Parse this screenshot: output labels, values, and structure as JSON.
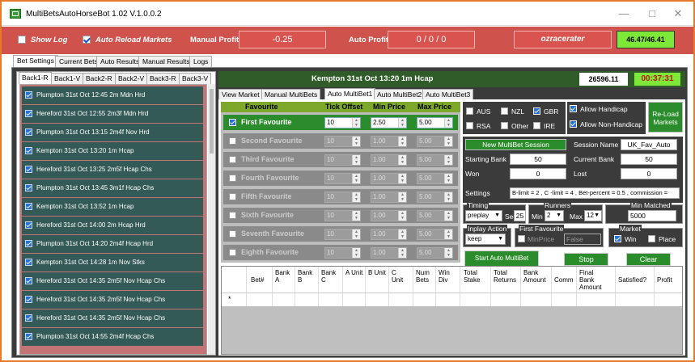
{
  "window": {
    "title": "MultiBetsAutoHorseBot 1.02 V.1.0.0.2",
    "minimize": "—",
    "maximize": "□",
    "close": "✕"
  },
  "toolbar": {
    "show_log": "Show Log",
    "auto_reload": "Auto Reload Markets",
    "manual_profit_label": "Manual Profit",
    "manual_profit_value": "-0.25",
    "auto_profit_label": "Auto Profit",
    "auto_profit_value": "0 / 0 / 0",
    "username": "ozracerater",
    "balance": "46.47/46.41"
  },
  "main_tabs": [
    "Bet Settings",
    "Current Bets",
    "Auto Results",
    "Manual Results",
    "Logs"
  ],
  "left_tabs": [
    "Back1-R",
    "Back1-V",
    "Back2-R",
    "Back2-V",
    "Back3-R",
    "Back3-V"
  ],
  "races": [
    "Plumpton 31st Oct 12:45 2m Mdn Hrd",
    "Hereford 31st Oct 12:55 2m3f Mdn Hrd",
    "Plumpton 31st Oct 13:15 2m4f Nov Hrd",
    "Kempton 31st Oct 13:20 1m Hcap",
    "Hereford 31st Oct 13:25 2m5f Hcap Chs",
    "Plumpton 31st Oct 13:45 3m1f Hcap Chs",
    "Kempton 31st Oct 13:52 1m Hcap",
    "Hereford 31st Oct 14:00 2m Hcap Hrd",
    "Plumpton 31st Oct 14:20 2m4f Hcap Hrd",
    "Kempton 31st Oct 14:28 1m Nov Stks",
    "Hereford 31st Oct 14:35 2m5f Nov Hcap Chs",
    "Hereford 31st Oct 14:35 2m5f Nov Hcap Chs",
    "Hereford 31st Oct 14:35 2m5f Nov Hcap Chs",
    "Plumpton 31st Oct 14:55 2m4f Hcap Chs"
  ],
  "race_header": {
    "title": "Kempton 31st Oct 13:20 1m Hcap",
    "figure": "26596.11",
    "clock": "00:37:31"
  },
  "sub_tabs": [
    "View Market",
    "Manual MultiBets",
    "Auto MultiBet1",
    "Auto MultiBet2",
    "Auto MultiBet3"
  ],
  "fav_headers": {
    "favourite": "Favourite",
    "tick": "Tick Offset",
    "min": "Min Price",
    "max": "Max Price"
  },
  "favourites": [
    {
      "name": "First Favourite",
      "tick": "10",
      "min": "2.50",
      "max": "5.00",
      "checked": true
    },
    {
      "name": "Second Favourite",
      "tick": "10",
      "min": "1.00",
      "max": "5.00",
      "checked": false
    },
    {
      "name": "Third Favourite",
      "tick": "10",
      "min": "1.00",
      "max": "5.00",
      "checked": false
    },
    {
      "name": "Fourth Favourite",
      "tick": "10",
      "min": "1.00",
      "max": "5.00",
      "checked": false
    },
    {
      "name": "Fifth Favourite",
      "tick": "10",
      "min": "1.00",
      "max": "5.00",
      "checked": false
    },
    {
      "name": "Sixth Favourite",
      "tick": "10",
      "min": "1.00",
      "max": "5.00",
      "checked": false
    },
    {
      "name": "Seventh Favourite",
      "tick": "10",
      "min": "1.00",
      "max": "5.00",
      "checked": false
    },
    {
      "name": "Eighth Favourite",
      "tick": "10",
      "min": "1.00",
      "max": "5.00",
      "checked": false
    }
  ],
  "countries": {
    "aus": "AUS",
    "nzl": "NZL",
    "gbr": "GBR",
    "rsa": "RSA",
    "other": "Other",
    "ire": "IRE"
  },
  "handicap": {
    "allow": "Allow Handicap",
    "allow_non": "Allow Non-Handicap"
  },
  "reload_label": "Re-Load Markets",
  "session": {
    "new_btn": "New MultiBet Session",
    "session_name_label": "Session Name",
    "session_name": "UK_Fav_Auto",
    "starting_bank_label": "Starting Bank",
    "starting_bank": "50",
    "current_bank_label": "Current Bank",
    "current_bank": "50",
    "won_label": "Won",
    "won": "0",
    "lost_label": "Lost",
    "lost": "0",
    "settings_label": "Settings",
    "settings": "B-limit = 2 , C -limit = 4 , Bet-percent = 0.5 , commission ="
  },
  "timing": {
    "label": "Timing",
    "mode": "preplay",
    "sec_label": "Sec",
    "sec": "25"
  },
  "runners": {
    "label": "Runners",
    "min_label": "Min",
    "min": "2",
    "max_label": "Max",
    "max": "12"
  },
  "min_matched": {
    "label": "Min Matched",
    "value": "5000"
  },
  "inplay": {
    "label": "Inplay Action",
    "value": "keep"
  },
  "first_fav": {
    "label": "First Favourite",
    "minprice_label": "MinPrice",
    "value": "False"
  },
  "market": {
    "label": "Market",
    "win": "Win",
    "place": "Place"
  },
  "buttons": {
    "start": "Start Auto MultiBet",
    "stop": "Stop",
    "clear": "Clear"
  },
  "grid": {
    "columns": [
      "Bet#",
      "Bank A",
      "Bank B",
      "Bank C",
      "A Unit",
      "B Unit",
      "C Unit",
      "Num Bets",
      "Win Div",
      "Total Stake",
      "Total Returns",
      "Bank Amount",
      "Comm",
      "Final Bank Amount",
      "Satisfied?",
      "Profit"
    ],
    "new_row_marker": "*"
  },
  "colors": {
    "toolbar": "#d0524d",
    "accent_green": "#2a8c2a",
    "clock_green": "#7ee838",
    "clock_text": "#c31313",
    "frame": "#e87a2c"
  }
}
